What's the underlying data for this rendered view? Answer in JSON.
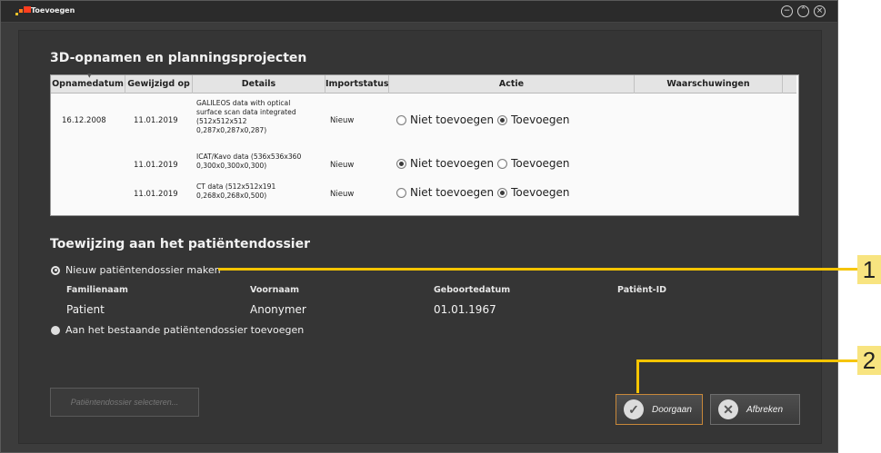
{
  "window": {
    "title": "Toevoegen",
    "controls": [
      "minimize-icon",
      "maximize-icon",
      "close-icon"
    ]
  },
  "imports": {
    "title": "3D-opnamen en planningsprojecten",
    "columns": [
      "Opnamedatum",
      "Gewijzigd op",
      "Details",
      "Importstatus",
      "Actie",
      "Waarschuwingen"
    ],
    "rows": [
      {
        "date": "16.12.2008",
        "modified": "11.01.2019",
        "details": [
          "GALILEOS data with optical",
          "surface scan data integrated",
          "(512x512x512",
          "0,287x0,287x0,287)"
        ],
        "status": "Nieuw",
        "action": "Toevoegen"
      },
      {
        "date": "",
        "modified": "11.01.2019",
        "details": [
          "ICAT/Kavo data (536x536x360",
          "0,300x0,300x0,300)"
        ],
        "status": "Nieuw",
        "action": "Niet toevoegen"
      },
      {
        "date": "",
        "modified": "11.01.2019",
        "details": [
          "CT data (512x512x191",
          "0,268x0,268x0,500)"
        ],
        "status": "Nieuw",
        "action": "Toevoegen"
      }
    ],
    "option_not_add": "Niet toevoegen",
    "option_add": "Toevoegen"
  },
  "assignment": {
    "title": "Toewijzing aan het patiëntendossier",
    "option_new": "Nieuw patiëntendossier maken",
    "option_existing": "Aan het bestaande patiëntendossier toevoegen",
    "selected": "new",
    "labels": {
      "last_name": "Familienaam",
      "first_name": "Voornaam",
      "birth_date": "Geboortedatum",
      "patient_id": "Patiënt-ID"
    },
    "values": {
      "last_name": "Patient",
      "first_name": "Anonymer",
      "birth_date": "01.01.1967",
      "patient_id": ""
    },
    "select_button": "Patiëntendossier selecteren..."
  },
  "buttons": {
    "continue": "Doorgaan",
    "cancel": "Afbreken"
  },
  "callouts": [
    "1",
    "2"
  ],
  "colors": {
    "callout": "#f6c500",
    "callout_box": "#f8e480",
    "accent_border": "#c8883a"
  }
}
